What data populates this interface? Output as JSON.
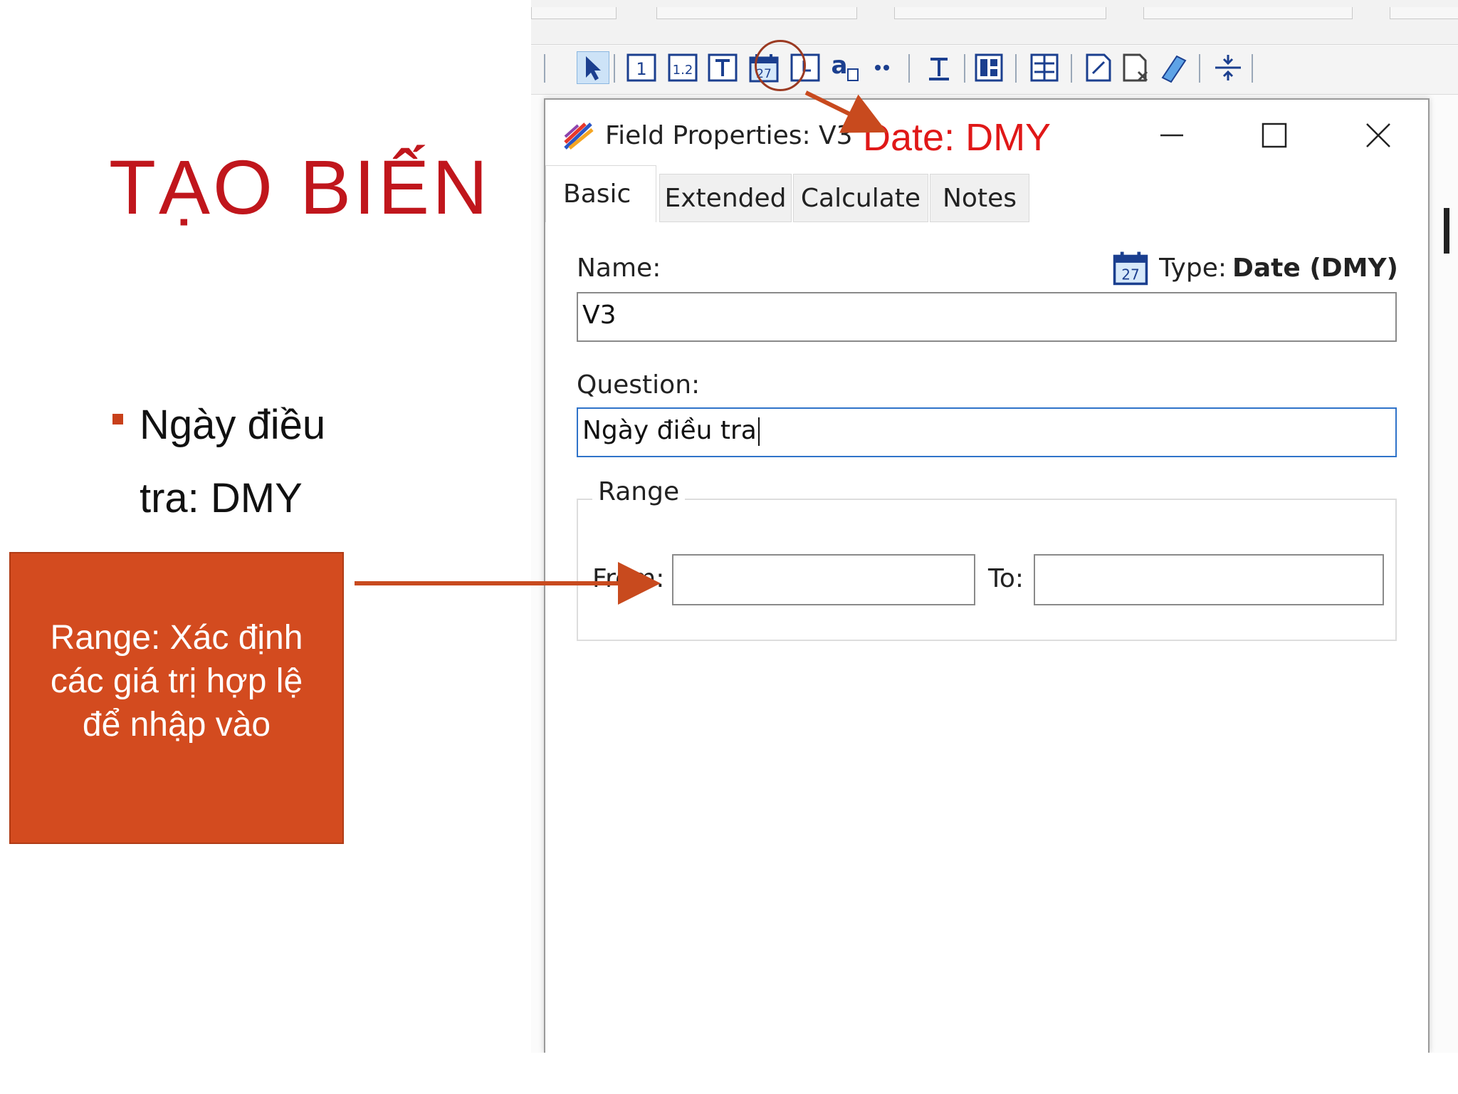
{
  "slide": {
    "title": "TẠO BIẾN",
    "bullet": "Ngày điều tra: DMY",
    "callout": [
      "Range: Xác định",
      "các giá trị hợp lệ",
      "để nhập vào"
    ],
    "date_annotation": "Date: DMY"
  },
  "dialog": {
    "title": "Field Properties: V3",
    "tabs": [
      "Basic",
      "Extended",
      "Calculate",
      "Notes"
    ],
    "active_tab": "Basic",
    "name_label": "Name:",
    "name_value": "V3",
    "type_label": "Type:",
    "type_value": "Date (DMY)",
    "question_label": "Question:",
    "question_value": "Ngày điều tra",
    "range_label": "Range",
    "from_label": "From:",
    "from_value": "",
    "to_label": "To:",
    "to_value": ""
  },
  "toolbar": {
    "icons": [
      "select-pointer-icon",
      "integer-field-icon",
      "float-field-icon",
      "text-field-icon",
      "date-field-icon",
      "time-field-icon",
      "auto-increment-icon",
      "more-icon",
      "heading-icon",
      "section-icon",
      "align-icon",
      "edit-field-icon",
      "delete-field-icon",
      "eraser-icon",
      "spacing-icon"
    ],
    "date_icon_text": "27",
    "int_icon_text": "1",
    "float_icon_text": "1.2"
  },
  "colors": {
    "title_red": "#c0161c",
    "callout_bg": "#d34b1f",
    "annotation_red": "#e01818",
    "arrow": "#c84a1e",
    "focus_blue": "#2f73c9"
  }
}
